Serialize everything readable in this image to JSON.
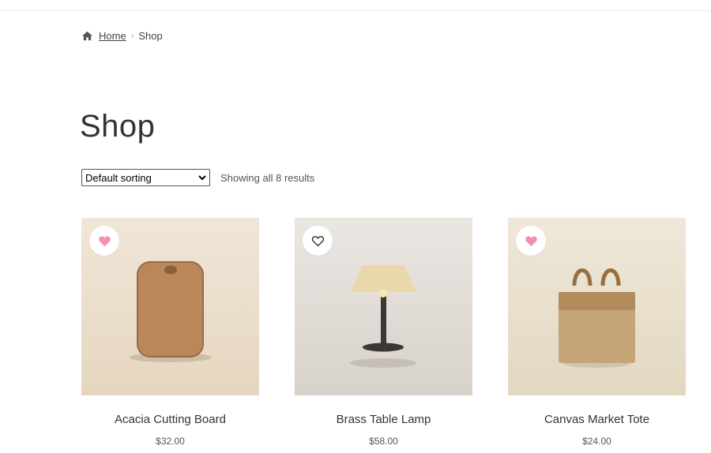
{
  "breadcrumb": {
    "home_label": "Home",
    "current": "Shop"
  },
  "page": {
    "title": "Shop"
  },
  "toolbar": {
    "sort_selected": "Default sorting",
    "result_count": "Showing all 8 results"
  },
  "products": [
    {
      "name": "Acacia Cutting Board",
      "price": "$32.00",
      "wishlisted": true,
      "icon": "cutting-board"
    },
    {
      "name": "Brass Table Lamp",
      "price": "$58.00",
      "wishlisted": false,
      "icon": "table-lamp"
    },
    {
      "name": "Canvas Market Tote",
      "price": "$24.00",
      "wishlisted": true,
      "icon": "tote-bag"
    }
  ],
  "colors": {
    "wishlist_active": "#f48fb1",
    "wishlist_inactive": "#333333"
  }
}
